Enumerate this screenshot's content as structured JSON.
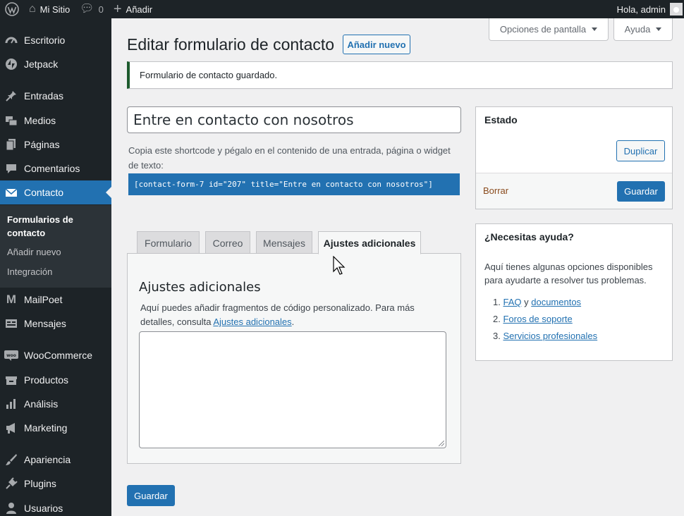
{
  "adminbar": {
    "site_name": "Mi Sitio",
    "comments_count": "0",
    "add_label": "Añadir",
    "greeting": "Hola, admin"
  },
  "sidebar": {
    "items": [
      {
        "label": "Escritorio",
        "icon": "dashboard-icon"
      },
      {
        "label": "Jetpack",
        "icon": "jetpack-icon"
      },
      {
        "label": "Entradas",
        "icon": "pin-icon"
      },
      {
        "label": "Medios",
        "icon": "media-icon"
      },
      {
        "label": "Páginas",
        "icon": "pages-icon"
      },
      {
        "label": "Comentarios",
        "icon": "comments-icon"
      },
      {
        "label": "Contacto",
        "icon": "mail-icon"
      },
      {
        "label": "MailPoet",
        "icon": "mailpoet-icon"
      },
      {
        "label": "Mensajes",
        "icon": "messages-icon"
      },
      {
        "label": "WooCommerce",
        "icon": "woocommerce-icon"
      },
      {
        "label": "Productos",
        "icon": "products-icon"
      },
      {
        "label": "Análisis",
        "icon": "analytics-icon"
      },
      {
        "label": "Marketing",
        "icon": "megaphone-icon"
      },
      {
        "label": "Apariencia",
        "icon": "brush-icon"
      },
      {
        "label": "Plugins",
        "icon": "plugin-icon"
      },
      {
        "label": "Usuarios",
        "icon": "users-icon"
      }
    ],
    "submenu": [
      {
        "label": "Formularios de contacto"
      },
      {
        "label": "Añadir nuevo"
      },
      {
        "label": "Integración"
      }
    ]
  },
  "screen_options": {
    "options_label": "Opciones de pantalla",
    "help_label": "Ayuda"
  },
  "main": {
    "title": "Editar formulario de contacto",
    "add_new_label": "Añadir nuevo",
    "notice": "Formulario de contacto guardado.",
    "form_title_value": "Entre en contacto con nosotros",
    "shortcode_desc": "Copia este shortcode y pégalo en el contenido de una entrada, página o widget de texto:",
    "shortcode": "[contact-form-7 id=\"207\" title=\"Entre en contacto con nosotros\"]",
    "tabs": [
      {
        "label": "Formulario"
      },
      {
        "label": "Correo"
      },
      {
        "label": "Mensajes"
      },
      {
        "label": "Ajustes adicionales"
      }
    ],
    "panel_title": "Ajustes adicionales",
    "panel_desc_prefix": "Aquí puedes añadir fragmentos de código personalizado. Para más detalles, consulta ",
    "panel_desc_link": "Ajustes adicionales",
    "panel_desc_suffix": ".",
    "save_label": "Guardar"
  },
  "status_box": {
    "title": "Estado",
    "duplicate_label": "Duplicar",
    "delete_label": "Borrar",
    "save_label": "Guardar"
  },
  "help_box": {
    "title": "¿Necesitas ayuda?",
    "desc": "Aquí tienes algunas opciones disponibles para ayudarte a resolver tus problemas.",
    "item1_link1": "FAQ",
    "item1_sep": "y",
    "item1_link2": "documentos",
    "item2_link": "Foros de soporte",
    "item3_link": "Servicios profesionales"
  },
  "colors": {
    "admin_dark": "#1d2327",
    "accent": "#2271b1",
    "background": "#f0f0f1"
  }
}
